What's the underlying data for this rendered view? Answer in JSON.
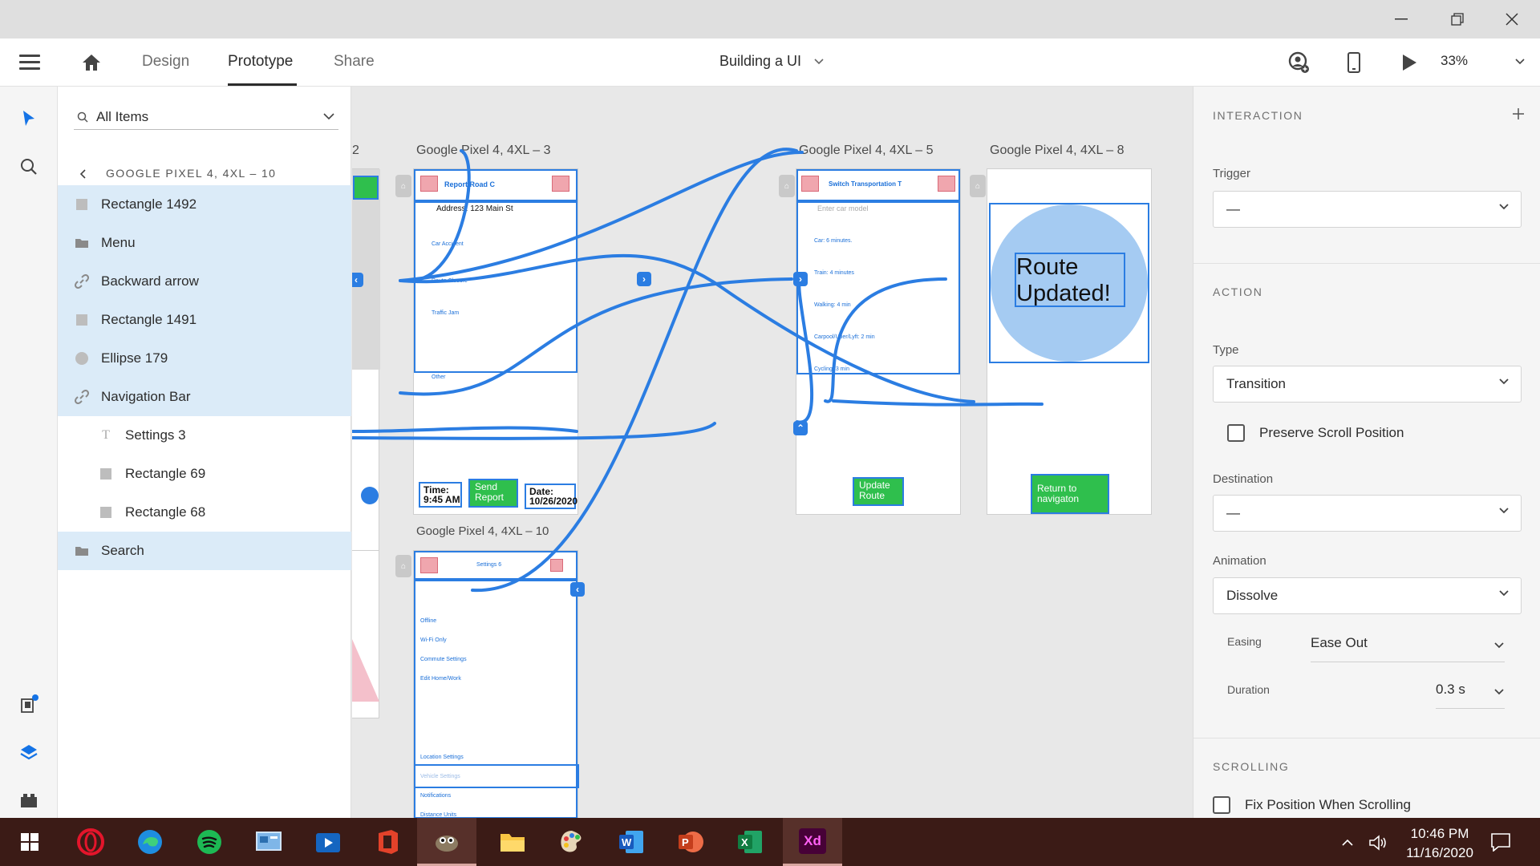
{
  "window": {
    "minimize": "—",
    "restore": "❐",
    "close": "✕"
  },
  "menubar": {
    "tabs": [
      {
        "label": "Design"
      },
      {
        "label": "Prototype"
      },
      {
        "label": "Share"
      }
    ],
    "doc_title": "Building a UI",
    "zoom": "33%"
  },
  "layers": {
    "filter": "All Items",
    "breadcrumb": "GOOGLE PIXEL 4, 4XL – 10",
    "items": [
      {
        "label": "Rectangle 1492",
        "icon": "rectangle-icon"
      },
      {
        "label": "Menu",
        "icon": "folder-icon"
      },
      {
        "label": "Backward arrow",
        "icon": "link-icon"
      },
      {
        "label": "Rectangle 1491",
        "icon": "rectangle-icon"
      },
      {
        "label": "Ellipse 179",
        "icon": "ellipse-icon"
      },
      {
        "label": "Navigation Bar",
        "icon": "link-icon"
      },
      {
        "label": "Settings 3",
        "icon": "text-icon"
      },
      {
        "label": "Rectangle 69",
        "icon": "rectangle-icon"
      },
      {
        "label": "Rectangle 68",
        "icon": "rectangle-icon"
      },
      {
        "label": "Search",
        "icon": "folder-icon"
      }
    ]
  },
  "canvas": {
    "artboards": {
      "left_partial_title": "2",
      "report": {
        "title": "Google Pixel 4, 4XL – 3",
        "header": "Report Road C",
        "address": "Address: 123 Main St",
        "options": [
          "Car Accident",
          "Route Closure",
          "Traffic Jam",
          "Other"
        ],
        "time": "Time:\n9:45 AM",
        "send": "Send\nReport",
        "date": "Date:\n10/26/2020"
      },
      "transport": {
        "title": "Google Pixel 4, 4XL – 5",
        "header": "Switch Transportation T",
        "search_placeholder": "Enter car model",
        "options": [
          "Car: 6 minutes.",
          "Train: 4 minutes",
          "Walking: 4 min",
          "Carpool/Uber/Lyft: 2 min",
          "Cycling: 3 min"
        ],
        "update": "Update\nRoute"
      },
      "updated": {
        "title": "Google Pixel 4, 4XL – 8",
        "message": "Route\nUpdated!",
        "return": "Return to\nnavigaton"
      },
      "settings": {
        "title": "Google Pixel 4, 4XL – 10",
        "header": "Settings 6",
        "items": [
          "Offline",
          "Wi-Fi Only",
          "Commute Settings",
          "Edit Home/Work"
        ],
        "lower_items": [
          "Location Settings",
          "Vehicle Settings",
          "Notifications",
          "Distance Units"
        ]
      }
    }
  },
  "props": {
    "interaction_title": "INTERACTION",
    "trigger_label": "Trigger",
    "trigger_value": "—",
    "action_title": "ACTION",
    "type_label": "Type",
    "type_value": "Transition",
    "preserve_scroll": "Preserve Scroll Position",
    "destination_label": "Destination",
    "destination_value": "—",
    "animation_label": "Animation",
    "animation_value": "Dissolve",
    "easing_label": "Easing",
    "easing_value": "Ease Out",
    "duration_label": "Duration",
    "duration_value": "0.3 s",
    "scrolling_title": "SCROLLING",
    "fix_position": "Fix Position When Scrolling"
  },
  "taskbar": {
    "time": "10:46 PM",
    "date": "11/16/2020",
    "apps": [
      "opera-icon",
      "edge-icon",
      "spotify-icon",
      "control-panel-icon",
      "media-player-icon",
      "office-icon",
      "gimp-icon",
      "file-explorer-icon",
      "paint-icon",
      "word-icon",
      "powerpoint-icon",
      "excel-icon",
      "adobe-xd-icon"
    ],
    "xd_label": "Xd"
  },
  "colors": {
    "accent": "#2b7de2",
    "selection_bg": "#dbebf8",
    "wire": "#2b7de2",
    "taskbar": "#3b1b16",
    "green_button": "#2fbf4d",
    "ellipse_fill": "#a5cbf2"
  }
}
